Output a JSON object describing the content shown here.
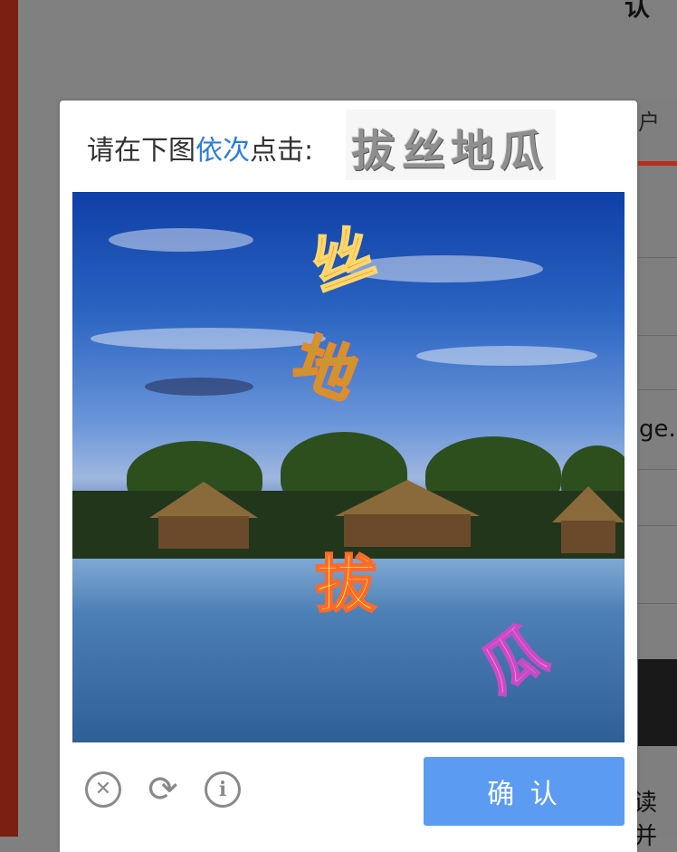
{
  "background": {
    "top_fragment": "认",
    "tab_fragment": "户",
    "row_fragment": "ge.",
    "bottom_fragment": "读并"
  },
  "captcha": {
    "instruction_prefix": "请在下图",
    "instruction_highlight": "依次",
    "instruction_suffix": "点击:",
    "hint_chars": [
      "拔",
      "丝",
      "地",
      "瓜"
    ],
    "image_chars": [
      "丝",
      "地",
      "拔",
      "瓜"
    ],
    "close_icon": "close-circle-icon",
    "refresh_icon": "refresh-icon",
    "info_icon": "info-icon",
    "confirm_label": "确 认"
  },
  "colors": {
    "highlight": "#2b7bdf",
    "confirm_bg": "#5b9cf2",
    "accent_red": "#b7301f"
  }
}
